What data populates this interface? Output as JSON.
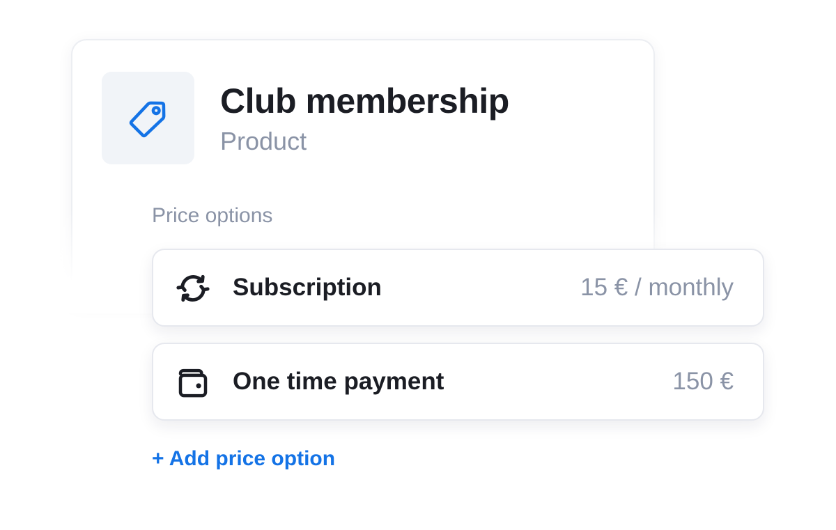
{
  "product": {
    "title": "Club membership",
    "type": "Product",
    "icon": "price-tag-icon"
  },
  "price_options": {
    "label": "Price options",
    "items": [
      {
        "name": "Subscription",
        "price": "15 € / monthly",
        "icon": "refresh-icon"
      },
      {
        "name": "One time payment",
        "price": "150 €",
        "icon": "wallet-icon"
      }
    ],
    "add_label": "+ Add price option"
  },
  "colors": {
    "accent": "#1473e6",
    "muted_text": "#8a93a6",
    "primary_text": "#1b1d24",
    "icon_tile_bg": "#f1f4f8"
  }
}
